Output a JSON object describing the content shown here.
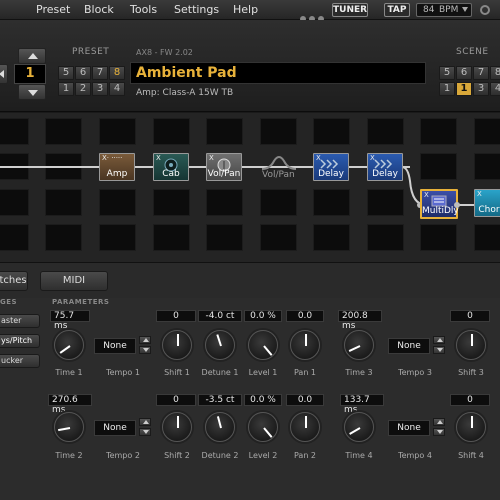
{
  "menu": [
    "Preset",
    "Block",
    "Tools",
    "Settings",
    "Help"
  ],
  "toolbar": {
    "tuner": "TUNER",
    "tap": "TAP",
    "bpm_value": "84",
    "bpm_unit": "BPM"
  },
  "preset": {
    "label": "PRESET",
    "number": "1",
    "grid": [
      "5",
      "6",
      "7",
      "8",
      "1",
      "2",
      "3",
      "4"
    ],
    "fw": "AX8 - FW 2.02",
    "name": "Ambient Pad",
    "amp": "Amp: Class-A 15W TB"
  },
  "scene": {
    "label": "SCENE",
    "grid": [
      "5",
      "6",
      "7",
      "8",
      "1",
      "2",
      "3",
      "4"
    ],
    "selected": "1"
  },
  "blocks": {
    "amp": "Amp",
    "cab": "Cab",
    "volpan": "Vol/Pan",
    "volpan_bypassed": "Vol/Pan",
    "delay1": "Delay",
    "delay2": "Delay",
    "multidly": "MultiDly",
    "chorus": "Chor"
  },
  "tabs": {
    "patches": "atches",
    "midi": "MIDI"
  },
  "panel": {
    "pages_label": "GES",
    "params_label": "PARAMETERS",
    "side": [
      "aster",
      "ys/Pitch",
      "ucker"
    ]
  },
  "row1": {
    "values": [
      "75.7 ms",
      "0",
      "-4.0 ct",
      "0.0 %",
      "0.0",
      "200.8 ms",
      "0"
    ],
    "selects": [
      "None",
      "None"
    ],
    "labels": [
      "Time 1",
      "Tempo 1",
      "Shift 1",
      "Detune 1",
      "Level 1",
      "Pan 1",
      "Time 3",
      "Tempo 3",
      "Shift 3"
    ]
  },
  "row2": {
    "values": [
      "270.6 ms",
      "0",
      "-3.5 ct",
      "0.0 %",
      "0.0",
      "133.7 ms",
      "0"
    ],
    "selects": [
      "None",
      "None"
    ],
    "labels": [
      "Time 2",
      "Tempo 2",
      "Shift 2",
      "Detune 2",
      "Level 2",
      "Pan 2",
      "Time 4",
      "Tempo 4",
      "Shift 4"
    ]
  }
}
